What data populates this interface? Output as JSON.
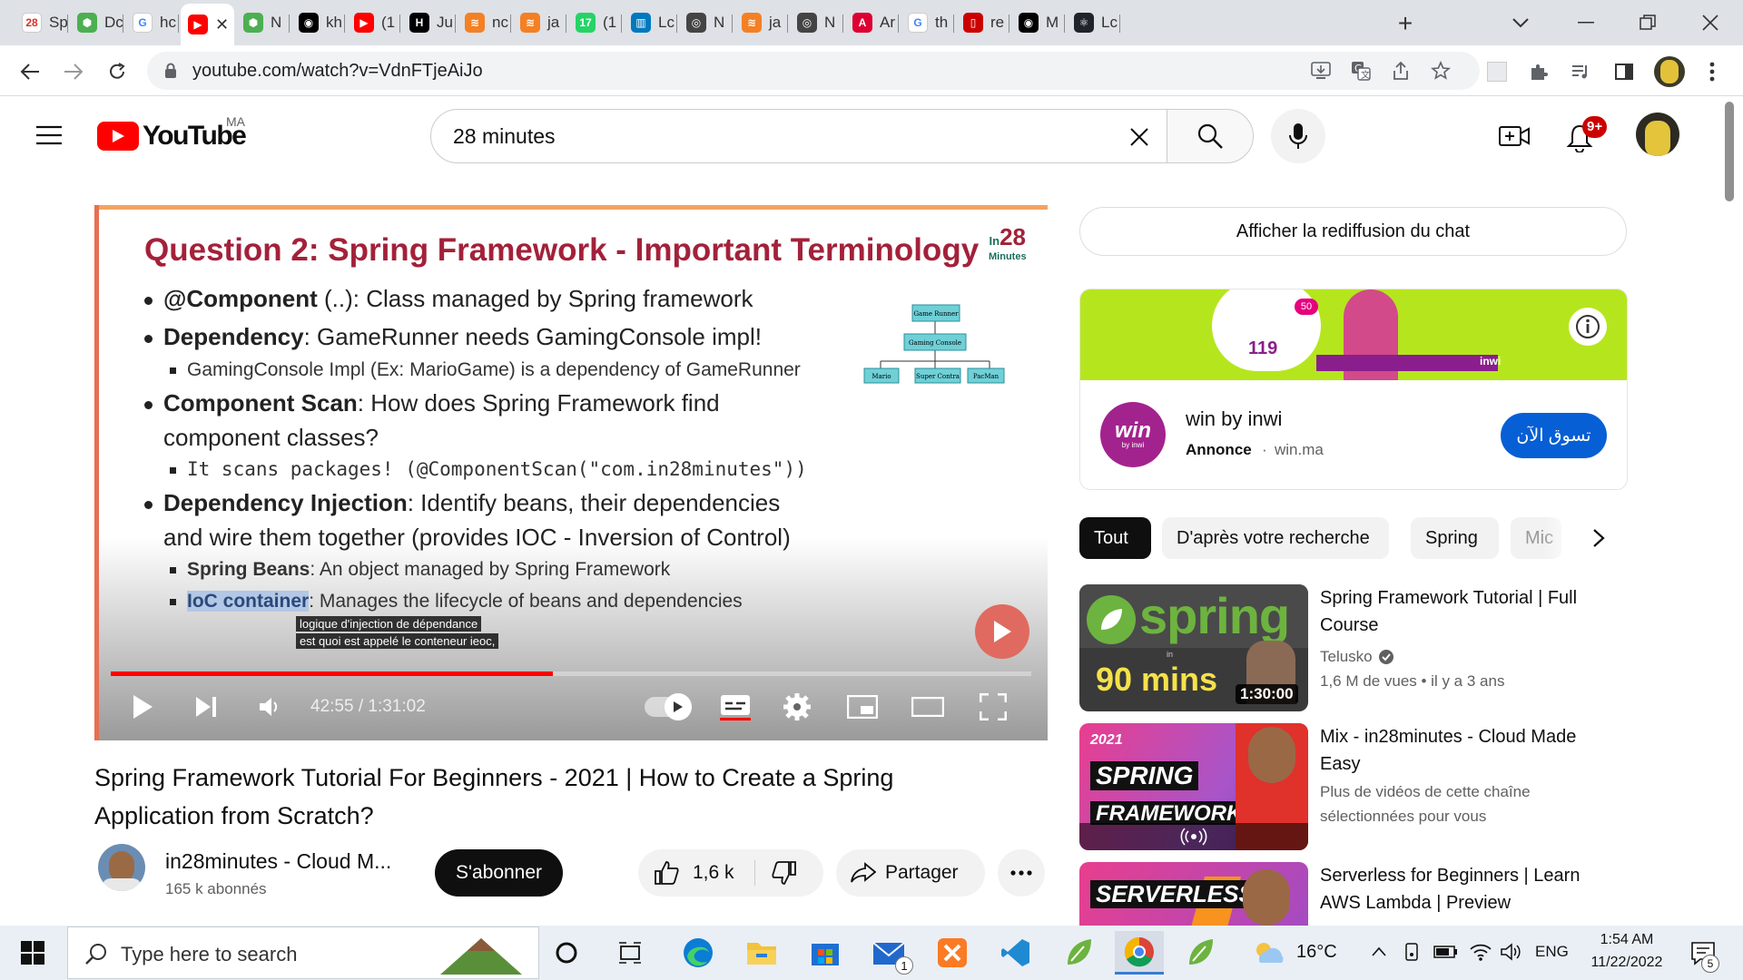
{
  "browser": {
    "tabs": [
      {
        "label": "Sp",
        "color": "#ffffff",
        "fg": "#d93025",
        "glyph": "28"
      },
      {
        "label": "Dc",
        "color": "#4caf50",
        "glyph": "⬢"
      },
      {
        "label": "hc",
        "color": "#ffffff",
        "fg": "#4285f4",
        "glyph": "G"
      },
      {
        "label": "",
        "color": "#ff0000",
        "glyph": "▶"
      },
      {
        "label": "N",
        "color": "#4caf50",
        "glyph": "⬢"
      },
      {
        "label": "kh",
        "color": "#000000",
        "glyph": "◉"
      },
      {
        "label": "(1",
        "color": "#ff0000",
        "glyph": "▶"
      },
      {
        "label": "Ju",
        "color": "#000000",
        "glyph": "H"
      },
      {
        "label": "nc",
        "color": "#f48024",
        "glyph": "≋"
      },
      {
        "label": "ja",
        "color": "#f48024",
        "glyph": "≋"
      },
      {
        "label": "(1",
        "color": "#25d366",
        "glyph": "17"
      },
      {
        "label": "Lc",
        "color": "#0079bf",
        "glyph": "▥"
      },
      {
        "label": "N",
        "color": "#444444",
        "glyph": "◎"
      },
      {
        "label": "ja",
        "color": "#f48024",
        "glyph": "≋"
      },
      {
        "label": "N",
        "color": "#444444",
        "glyph": "◎"
      },
      {
        "label": "Ar",
        "color": "#dd0031",
        "glyph": "A"
      },
      {
        "label": "th",
        "color": "#ffffff",
        "fg": "#4285f4",
        "glyph": "G"
      },
      {
        "label": "re",
        "color": "#cc0000",
        "glyph": "▯"
      },
      {
        "label": "M",
        "color": "#000000",
        "glyph": "◉"
      },
      {
        "label": "Lc",
        "color": "#20232a",
        "glyph": "⚛"
      }
    ],
    "url": "youtube.com/watch?v=VdnFTjeAiJo"
  },
  "youtube": {
    "logo_text": "YouTube",
    "country": "MA",
    "search_value": "28 minutes",
    "notif_count": "9+"
  },
  "video": {
    "slide_title": "Question 2: Spring Framework - Important Terminology",
    "brand_small": "In",
    "brand_big": "28",
    "brand_sub": "Minutes",
    "bullets": [
      {
        "bold": "@Component",
        "text": " (..): Class managed by Spring framework"
      },
      {
        "bold": "Dependency",
        "text": ": GameRunner needs GamingConsole impl!"
      },
      {
        "bold": "",
        "text": "GamingConsole Impl (Ex: MarioGame) is a dependency of GameRunner"
      },
      {
        "bold": "Component Scan",
        "text": ": How does Spring Framework find"
      },
      {
        "bold": "",
        "text": "component classes?"
      },
      {
        "bold": "",
        "text": "It scans packages! (@ComponentScan(\"com.in28minutes\"))"
      },
      {
        "bold": "Dependency Injection",
        "text": ": Identify beans, their dependencies"
      },
      {
        "bold": "",
        "text": "and wire them together (provides IOC - Inversion of Control)"
      },
      {
        "bold": "Spring Beans",
        "text": ": An object managed by Spring Framework"
      },
      {
        "bold": "IoC container",
        "text": ": Manages the lifecycle of beans and dependencies"
      }
    ],
    "diagram": {
      "top": "Game Runner",
      "mid": "Gaming Console",
      "leaves": [
        "Mario",
        "Super Contra",
        "PacMan"
      ]
    },
    "captions": [
      "logique d'injection de dépendance",
      "est quoi  est appelé le conteneur ieoc,"
    ],
    "time_current": "42:55",
    "time_total": "1:31:02",
    "progress": 0.48,
    "title": "Spring Framework Tutorial For Beginners - 2021 | How to Create a Spring Application from Scratch?",
    "channel": "in28minutes - Cloud M...",
    "subscribers": "165 k abonnés",
    "subscribe_label": "S'abonner",
    "likes": "1,6 k",
    "share_label": "Partager"
  },
  "sidebar": {
    "chat_button": "Afficher la rediffusion du chat",
    "ad": {
      "banner_price": "119",
      "banner_badge": "50",
      "banner_brand": "inwi",
      "logo_text": "win",
      "logo_sub": "by inwi",
      "title": "win by inwi",
      "label": "Annonce",
      "domain": "win.ma",
      "cta": "تسوق الآن"
    },
    "chips": [
      "Tout",
      "D'après votre recherche",
      "Spring",
      "Mic"
    ],
    "recommendations": [
      {
        "title": "Spring Framework Tutorial | Full Course",
        "channel": "Telusko",
        "meta": "1,6 M de vues  • il y a 3 ans",
        "duration": "1:30:00",
        "thumb_text": "spring",
        "thumb_sub": "90 mins",
        "thumb_mark": "in"
      },
      {
        "title": "Mix - in28minutes - Cloud Made Easy",
        "channel": "Plus de vidéos de cette chaîne sélectionnées pour vous",
        "meta": "",
        "duration": "",
        "thumb_text": "SPRING",
        "thumb_sub": "FRAMEWORK",
        "thumb_mark": "2021"
      },
      {
        "title": "Serverless for Beginners | Learn AWS Lambda | Preview",
        "channel": "",
        "meta": "",
        "duration": "",
        "thumb_text": "SERVERLESS",
        "thumb_sub": "",
        "thumb_mark": ""
      }
    ]
  },
  "taskbar": {
    "search_placeholder": "Type here to search",
    "weather": "16°C",
    "lang": "ENG",
    "time": "1:54 AM",
    "date": "11/22/2022",
    "notif": "5",
    "mail_badge": "1"
  }
}
